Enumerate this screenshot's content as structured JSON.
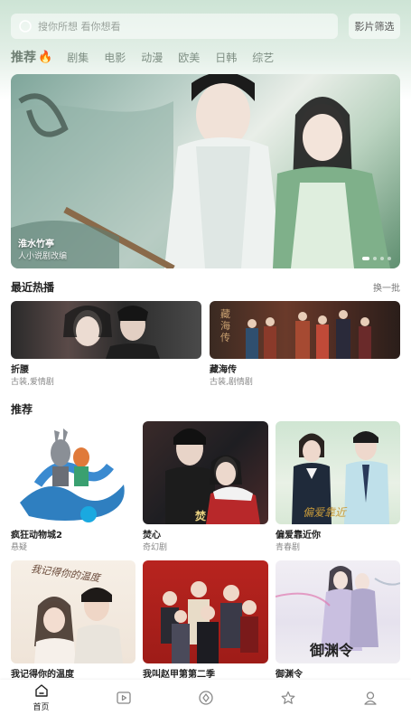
{
  "search": {
    "placeholder": "搜你所想 看你想看",
    "filter_label": "影片筛选"
  },
  "tabs": [
    "推荐",
    "剧集",
    "电影",
    "动漫",
    "欧美",
    "日韩",
    "综艺"
  ],
  "banner": {
    "title": "淮水竹亭",
    "subtitle": "人小说剧改编",
    "dot_count": 4,
    "active_dot": 0
  },
  "recent": {
    "title": "最近热播",
    "refresh_label": "换一批",
    "items": [
      {
        "title": "折腰",
        "tags": "古装,爱情剧",
        "poster_text": ""
      },
      {
        "title": "藏海传",
        "tags": "古装,剧情剧",
        "poster_text": "藏海传"
      }
    ]
  },
  "recommend": {
    "title": "推荐",
    "items": [
      {
        "title": "疯狂动物城2",
        "tags": "悬疑",
        "poster_text": ""
      },
      {
        "title": "焚心",
        "tags": "奇幻剧",
        "poster_text": "焚"
      },
      {
        "title": "偏爱靠近你",
        "tags": "青春剧",
        "poster_text": "偏爱靠近"
      },
      {
        "title": "我记得你的温度",
        "tags": "",
        "poster_text": "我记得你的温度"
      },
      {
        "title": "我叫赵甲第第二季",
        "tags": "",
        "poster_text": ""
      },
      {
        "title": "御渊令",
        "tags": "",
        "poster_text": "御渊令"
      }
    ]
  },
  "bottom_nav": [
    {
      "label": "首页",
      "icon": "home-icon"
    },
    {
      "label": "",
      "icon": "video-icon"
    },
    {
      "label": "",
      "icon": "discover-icon"
    },
    {
      "label": "",
      "icon": "star-icon"
    },
    {
      "label": "",
      "icon": "user-icon"
    }
  ],
  "colors": {
    "accent": "#6f7f74",
    "header_bg": "#cde4d5",
    "fire": "#ff6a2a"
  }
}
